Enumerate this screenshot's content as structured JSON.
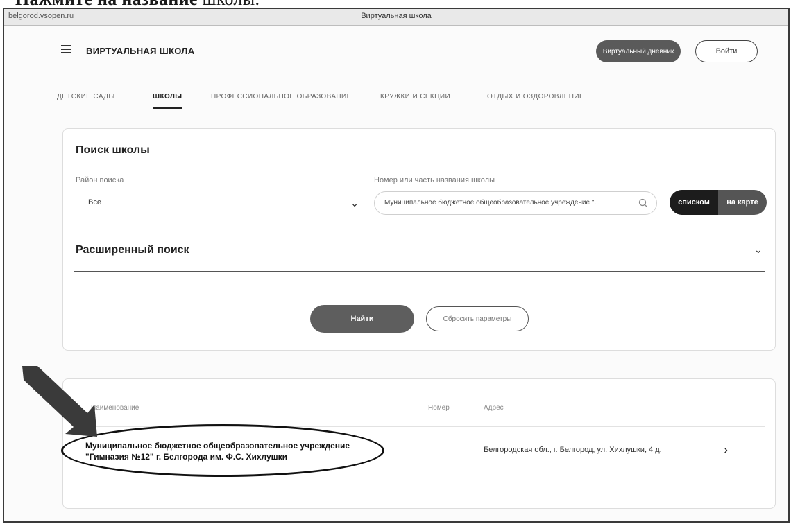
{
  "doc_heading": {
    "strong": "Нажмите на название",
    "light": "школы."
  },
  "browser": {
    "url": "belgorod.vsopen.ru",
    "window_title": "Виртуальная школа"
  },
  "header": {
    "brand": "ВИРТУАЛЬНАЯ ШКОЛА",
    "diary_button": "Виртуальный дневник",
    "login_button": "Войти"
  },
  "tabs": [
    {
      "label": "ДЕТСКИЕ САДЫ"
    },
    {
      "label": "ШКОЛЫ"
    },
    {
      "label": "ПРОФЕССИОНАЛЬНОЕ ОБРАЗОВАНИЕ"
    },
    {
      "label": "КРУЖКИ И СЕКЦИИ"
    },
    {
      "label": "ОТДЫХ И ОЗДОРОВЛЕНИЕ"
    }
  ],
  "search": {
    "title": "Поиск школы",
    "district_label": "Район поиска",
    "district_value": "Все",
    "name_label": "Номер или часть названия школы",
    "name_value": "Муниципальное бюджетное общеобразовательное учреждение \"...",
    "view_list": "списком",
    "view_map": "на карте",
    "advanced": "Расширенный поиск",
    "find_button": "Найти",
    "reset_button": "Сбросить параметры"
  },
  "results": {
    "col_name": "Наименование",
    "col_number": "Номер",
    "col_address": "Адрес",
    "rows": [
      {
        "name": "Муниципальное бюджетное общеобразовательное учреждение \"Гимназия №12\" г. Белгорода им. Ф.С. Хихлушки",
        "address": "Белгородская обл., г. Белгород, ул. Хихлушки, 4 д."
      }
    ]
  }
}
